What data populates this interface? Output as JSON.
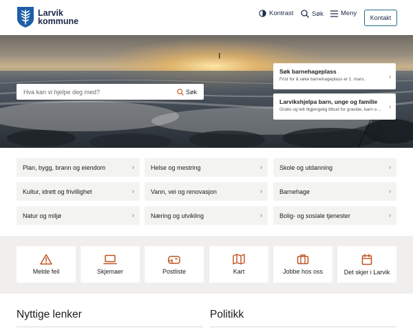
{
  "header": {
    "logo_line1": "Larvik",
    "logo_line2": "kommune",
    "contrast_label": "Kontrast",
    "search_label": "Søk",
    "menu_label": "Meny",
    "contact_label": "Kontakt"
  },
  "hero": {
    "search_placeholder": "Hva kan vi hjelpe deg med?",
    "search_button": "Søk",
    "promos": [
      {
        "title": "Søk barnehageplass",
        "subtitle": "Frist for å søke barnehageplass er 1. mars."
      },
      {
        "title": "Larvikshjelpa barn, unge og familie",
        "subtitle": "Gratis og lett tilgjengelig tilbud for gravide, barn og unge"
      }
    ]
  },
  "categories": [
    "Plan, bygg, brann og eiendom",
    "Helse og mestring",
    "Skole og utdanning",
    "Kultur, idrett og frivillighet",
    "Vann, vei og renovasjon",
    "Barnehage",
    "Natur og miljø",
    "Næring og utvikling",
    "Bolig- og sosiale tjenester"
  ],
  "quick_links": [
    {
      "label": "Melde feil",
      "icon": "warning-icon"
    },
    {
      "label": "Skjemaer",
      "icon": "laptop-icon"
    },
    {
      "label": "Postliste",
      "icon": "mailbox-icon"
    },
    {
      "label": "Kart",
      "icon": "map-icon"
    },
    {
      "label": "Jobbe hos oss",
      "icon": "briefcase-icon"
    },
    {
      "label": "Det skjer i Larvik",
      "icon": "calendar-icon"
    }
  ],
  "sections": {
    "useful_links": "Nyttige lenker",
    "politics": "Politikk"
  },
  "colors": {
    "brand_navy": "#1b2a49",
    "brand_blue": "#1f5fa8",
    "accent_orange": "#c0501f",
    "tile_gray": "#f3f3f2"
  }
}
